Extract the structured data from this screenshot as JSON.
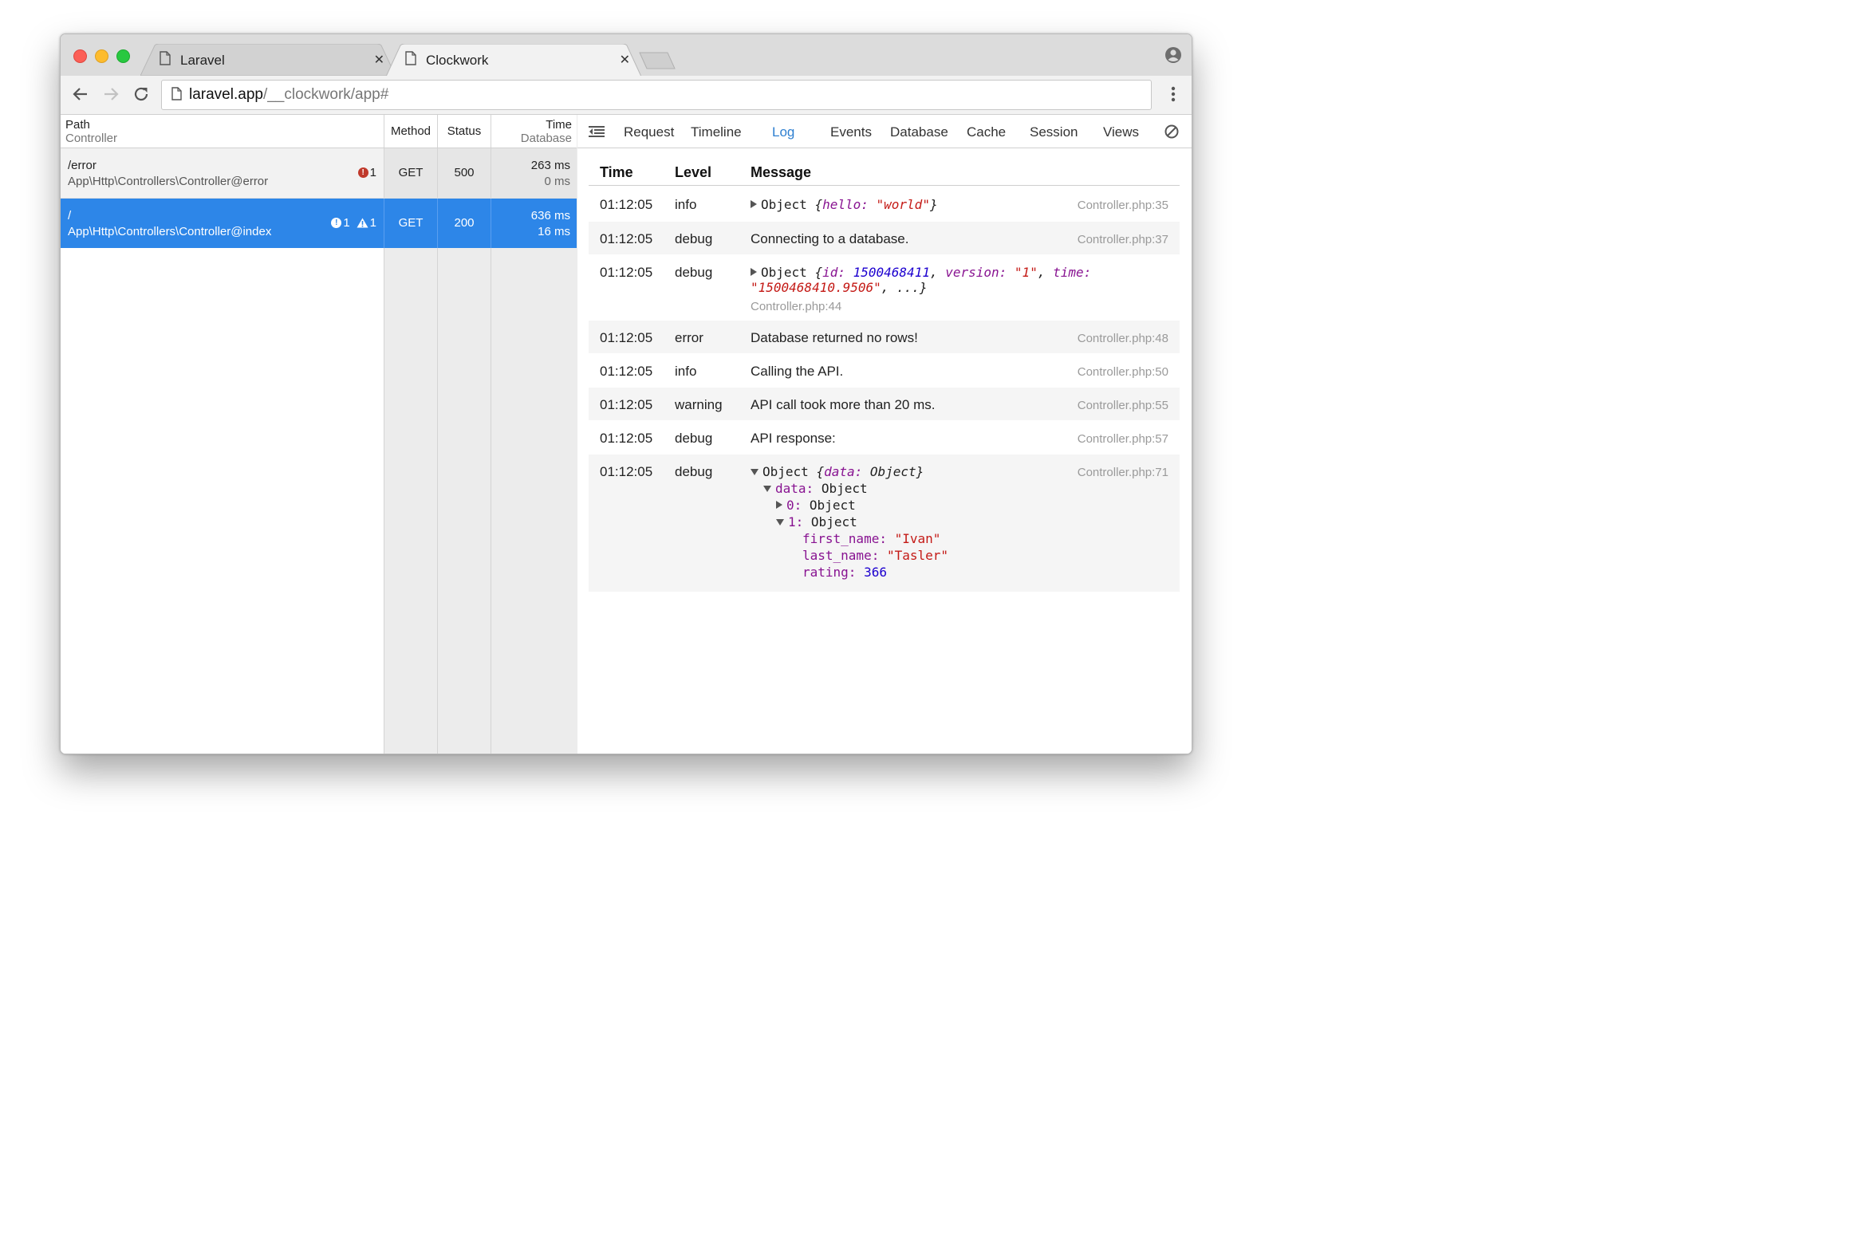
{
  "browser": {
    "tabs": [
      {
        "title": "Laravel",
        "active": false
      },
      {
        "title": "Clockwork",
        "active": true
      }
    ],
    "url": {
      "host": "laravel.app",
      "path": "/__clockwork/app#"
    },
    "icons": [
      "back-icon",
      "forward-icon",
      "reload-icon",
      "page-icon",
      "menu-icon",
      "profile-icon"
    ]
  },
  "requests": {
    "headers": {
      "path": "Path",
      "controller": "Controller",
      "method": "Method",
      "status": "Status",
      "time": "Time",
      "database": "Database"
    },
    "rows": [
      {
        "path": "/error",
        "controller": "App\\Http\\Controllers\\Controller@error",
        "method": "GET",
        "status": "500",
        "time": "263 ms",
        "database": "0 ms",
        "errors": "1",
        "warnings": null,
        "selected": false
      },
      {
        "path": "/",
        "controller": "App\\Http\\Controllers\\Controller@index",
        "method": "GET",
        "status": "200",
        "time": "636 ms",
        "database": "16 ms",
        "errors": "1",
        "warnings": "1",
        "selected": true
      }
    ]
  },
  "detail": {
    "tabs": [
      "Request",
      "Timeline",
      "Log",
      "Events",
      "Database",
      "Cache",
      "Session",
      "Views"
    ],
    "active_tab": "Log",
    "log": {
      "columns": {
        "time": "Time",
        "level": "Level",
        "message": "Message"
      },
      "entries": [
        {
          "time": "01:12:05",
          "level": "info",
          "message": "Object {hello: \"world\"}",
          "file": "Controller.php:35"
        },
        {
          "time": "01:12:05",
          "level": "debug",
          "message": "Connecting to a database.",
          "file": "Controller.php:37"
        },
        {
          "time": "01:12:05",
          "level": "debug",
          "message": "Object {id: 1500468411, version: \"1\", time: \"1500468410.9506\", ...}",
          "file": "Controller.php:44"
        },
        {
          "time": "01:12:05",
          "level": "error",
          "message": "Database returned no rows!",
          "file": "Controller.php:48"
        },
        {
          "time": "01:12:05",
          "level": "info",
          "message": "Calling the API.",
          "file": "Controller.php:50"
        },
        {
          "time": "01:12:05",
          "level": "warning",
          "message": "API call took more than 20 ms.",
          "file": "Controller.php:55"
        },
        {
          "time": "01:12:05",
          "level": "debug",
          "message": "API response:",
          "file": "Controller.php:57"
        },
        {
          "time": "01:12:05",
          "level": "debug",
          "message": "Object {data: Object}",
          "file": "Controller.php:71",
          "tree": {
            "data_key": "data",
            "data_val": "Object",
            "item0_key": "0",
            "item0_val": "Object",
            "item1_key": "1",
            "item1_val": "Object",
            "first_name_key": "first_name",
            "first_name_val": "\"Ivan\"",
            "last_name_key": "last_name",
            "last_name_val": "\"Tasler\"",
            "rating_key": "rating",
            "rating_val": "366"
          }
        }
      ]
    }
  },
  "colors": {
    "accent": "#2d86e8",
    "active_tab": "#2f80d1",
    "error": "#c0392b"
  }
}
